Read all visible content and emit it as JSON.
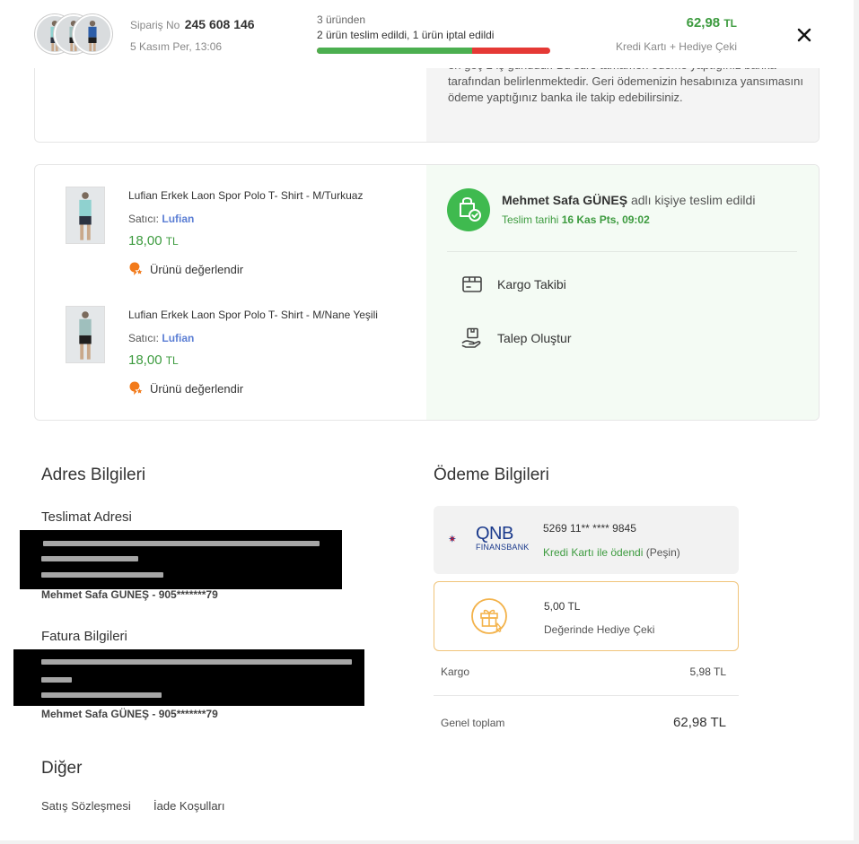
{
  "header": {
    "order_no_label": "Sipariş No",
    "order_no": "245 608 146",
    "order_date": "5 Kasım Per, 13:06",
    "progress_title": "3 üründen",
    "progress_status": "2 ürün teslim edildi, 1 ürün iptal edildi",
    "progress_delivered_fraction": 0.667,
    "total_amount": "62,98",
    "currency": "TL",
    "payment_method": "Kredi Kartı + Hediye Çeki",
    "close_icon": "close-icon"
  },
  "refund": {
    "text_partial": "en geç 2 iş günüdür. Bu süre tamamen ödeme yaptığınız banka tarafından belirlenmektedir. Geri ödemenizin hesabınıza yansımasını ödeme yaptığınız banka ile takip edebilirsiniz."
  },
  "products": [
    {
      "name": "Lufian Erkek Laon Spor Polo T- Shirt - M/Turkuaz",
      "seller_label": "Satıcı:",
      "seller": "Lufian",
      "price": "18,00",
      "currency": "TL",
      "rate_label": "Ürünü değerlendir",
      "shirt_color": "#8fd1cf",
      "shorts_color": "#2b3240"
    },
    {
      "name": "Lufian Erkek Laon Spor Polo T- Shirt - M/Nane Yeşili",
      "seller_label": "Satıcı:",
      "seller": "Lufian",
      "price": "18,00",
      "currency": "TL",
      "rate_label": "Ürünü değerlendir",
      "shirt_color": "#9fbfbd",
      "shorts_color": "#1e1e1e"
    }
  ],
  "delivery": {
    "recipient": "Mehmet Safa GÜNEŞ",
    "recipient_suffix": "adlı kişiye teslim edildi",
    "date_label": "Teslim tarihi",
    "date": "16 Kas Pts, 09:02",
    "actions": [
      {
        "label": "Kargo Takibi",
        "icon": "cargo-box-icon"
      },
      {
        "label": "Talep Oluştur",
        "icon": "hand-package-icon"
      }
    ]
  },
  "address": {
    "title": "Adres Bilgileri",
    "shipping_title": "Teslimat Adresi",
    "shipping_person": "Mehmet Safa GUNEŞ - 905*******79",
    "billing_title": "Fatura Bilgileri",
    "billing_person": "Mehmet Safa GÜNEŞ - 905*******79"
  },
  "payment": {
    "title": "Ödeme Bilgileri",
    "bank_logo_text": "QNB",
    "bank_logo_sub": "FINANSBANK",
    "card_number": "5269 11** **** 9845",
    "card_status": "Kredi Kartı ile ödendi",
    "card_status_suffix": "(Peşin)",
    "gift_amount": "5,00 TL",
    "gift_label": "Değerinde Hediye Çeki",
    "cargo_label": "Kargo",
    "cargo_value": "5,98 TL",
    "grand_total_label": "Genel toplam",
    "grand_total_value": "62,98 TL"
  },
  "other": {
    "title": "Diğer",
    "links": [
      "Satış Sözleşmesi",
      "İade Koşulları"
    ]
  },
  "colors": {
    "accent_green": "#3d9b3f",
    "cancel_red": "#e53935",
    "seller_blue": "#5b7ed4",
    "rate_orange": "#f27a1a"
  }
}
